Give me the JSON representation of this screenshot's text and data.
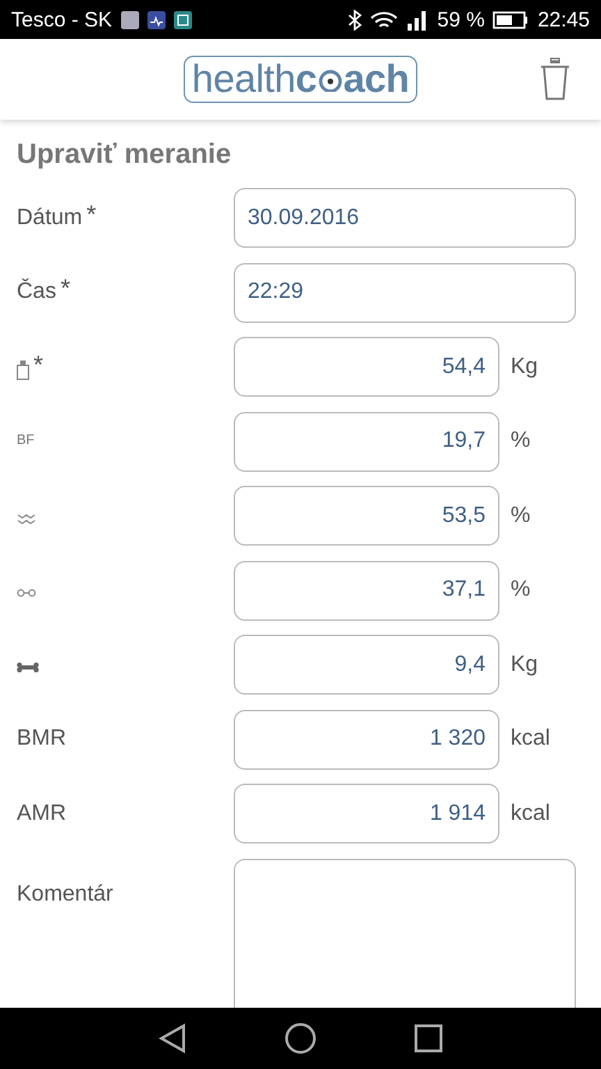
{
  "status_bar": {
    "carrier": "Tesco - SK",
    "battery": "59 %",
    "time": "22:45"
  },
  "header": {
    "logo": {
      "light": "health",
      "bold_start": "c",
      "bold_end": "ach"
    }
  },
  "title": "Upraviť meranie",
  "fields": [
    {
      "kind": "text",
      "label": "Dátum",
      "required_mark": "*",
      "value": "30.09.2016"
    },
    {
      "kind": "text",
      "label": "Čas",
      "required_mark": "*",
      "value": "22:29"
    },
    {
      "kind": "scale",
      "required_mark": "*",
      "value": "54,4",
      "unit": "Kg"
    },
    {
      "kind": "small",
      "label": "BF",
      "value": "19,7",
      "unit": "%"
    },
    {
      "kind": "water",
      "value": "53,5",
      "unit": "%"
    },
    {
      "kind": "muscle",
      "value": "37,1",
      "unit": "%"
    },
    {
      "kind": "bone",
      "value": "9,4",
      "unit": "Kg"
    },
    {
      "kind": "text",
      "label": "BMR",
      "value": "1 320",
      "unit": "kcal"
    },
    {
      "kind": "text",
      "label": "AMR",
      "value": "1 914",
      "unit": "kcal"
    },
    {
      "kind": "textarea",
      "label": "Komentár"
    }
  ]
}
